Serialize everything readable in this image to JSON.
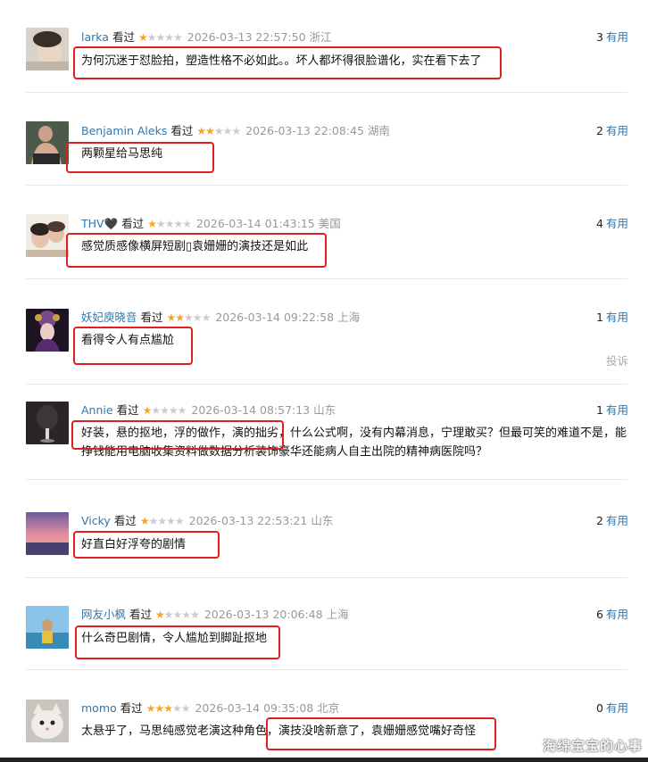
{
  "seen_label": "看过",
  "vote_label": "有用",
  "report_label": "投诉",
  "watermark": "海绵宝宝的心事",
  "comments": [
    {
      "user": "larka",
      "stars": 1,
      "time": "2026-03-13 22:57:50",
      "location": "浙江",
      "votes": "3",
      "content": "为何沉迷于怼脸拍，塑造性格不必如此。。坏人都坏得很脸谱化，实在看下去了"
    },
    {
      "user": "Benjamin Aleks",
      "stars": 2,
      "time": "2026-03-13 22:08:45",
      "location": "湖南",
      "votes": "2",
      "content": "两颗星给马思纯"
    },
    {
      "user": "THV🖤",
      "stars": 1,
      "time": "2026-03-14 01:43:15",
      "location": "美国",
      "votes": "4",
      "content": "感觉质感像横屏短剧▯袁姗姗的演技还是如此"
    },
    {
      "user": "妖妃庾晓音",
      "stars": 2,
      "time": "2026-03-14 09:22:58",
      "location": "上海",
      "votes": "1",
      "content": "看得令人有点尴尬"
    },
    {
      "user": "Annie",
      "stars": 1,
      "time": "2026-03-14 08:57:13",
      "location": "山东",
      "votes": "1",
      "content": "好装，悬的抠地，浮的做作，演的拙劣，什么公式啊，没有内幕消息，宁理敢买？但最可笑的难道不是，能挣钱能用电脑收集资料做数据分析装饰豪华还能病人自主出院的精神病医院吗？"
    },
    {
      "user": "Vicky",
      "stars": 1,
      "time": "2026-03-13 22:53:21",
      "location": "山东",
      "votes": "2",
      "content": "好直白好浮夸的剧情"
    },
    {
      "user": "网友小枫",
      "stars": 1,
      "time": "2026-03-13 20:06:48",
      "location": "上海",
      "votes": "6",
      "content": "什么奇巴剧情，令人尴尬到脚趾抠地"
    },
    {
      "user": "momo",
      "stars": 3,
      "time": "2026-03-14 09:35:08",
      "location": "北京",
      "votes": "0",
      "content": "太悬乎了，马思纯感觉老演这种角色，演技没啥新意了，袁姗姗感觉嘴好奇怪"
    }
  ]
}
